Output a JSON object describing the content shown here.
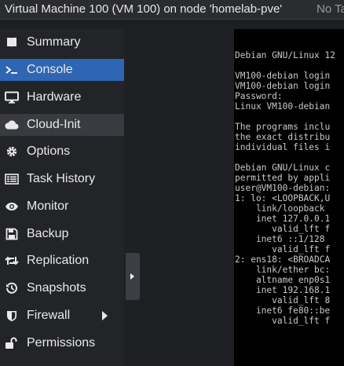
{
  "titlebar": {
    "title": "Virtual Machine 100 (VM 100) on node 'homelab-pve'",
    "tags": "No Ta"
  },
  "sidebar": {
    "items": [
      {
        "label": "Summary",
        "icon": "book-icon"
      },
      {
        "label": "Console",
        "icon": "terminal-icon"
      },
      {
        "label": "Hardware",
        "icon": "monitor-icon"
      },
      {
        "label": "Cloud-Init",
        "icon": "cloud-icon"
      },
      {
        "label": "Options",
        "icon": "gear-icon"
      },
      {
        "label": "Task History",
        "icon": "list-icon"
      },
      {
        "label": "Monitor",
        "icon": "eye-icon"
      },
      {
        "label": "Backup",
        "icon": "floppy-icon"
      },
      {
        "label": "Replication",
        "icon": "retweet-icon"
      },
      {
        "label": "Snapshots",
        "icon": "history-icon"
      },
      {
        "label": "Firewall",
        "icon": "shield-icon"
      },
      {
        "label": "Permissions",
        "icon": "unlock-icon"
      }
    ],
    "active": "Console",
    "hover": "Cloud-Init",
    "colors": {
      "active_bg": "#2f66b3",
      "hover_bg": "#3a3b40"
    }
  },
  "console": {
    "lines": [
      "",
      "Debian GNU/Linux 12",
      "",
      "VM100-debian login",
      "VM100-debian login",
      "Password:",
      "Linux VM100-debian",
      "",
      "The programs inclu",
      "the exact distribu",
      "individual files i",
      "",
      "Debian GNU/Linux c",
      "permitted by appli",
      "user@VM100-debian:",
      "1: lo: <LOOPBACK,U",
      "    link/loopback ",
      "    inet 127.0.0.1",
      "       valid_lft f",
      "    inet6 ::1/128 ",
      "       valid_lft f",
      "2: ens18: <BROADCA",
      "    link/ether bc:",
      "    altname enp0s1",
      "    inet 192.168.1",
      "       valid_lft 8",
      "    inet6 fe80::be",
      "       valid_lft f"
    ]
  }
}
